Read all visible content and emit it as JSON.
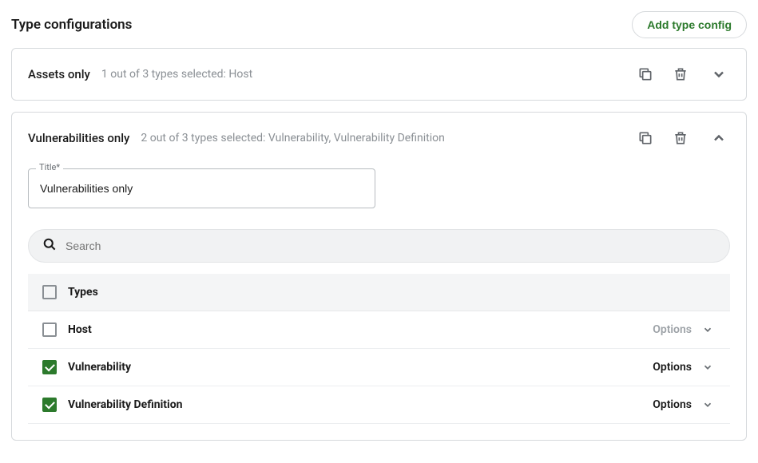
{
  "header": {
    "title": "Type configurations",
    "add_button": "Add type config"
  },
  "card1": {
    "title": "Assets only",
    "subtitle": "1 out of 3 types selected: Host"
  },
  "card2": {
    "title": "Vulnerabilities only",
    "subtitle": "2 out of 3 types selected: Vulnerability, Vulnerability Definition",
    "field_label": "Title*",
    "field_value": "Vulnerabilities only",
    "search_placeholder": "Search",
    "table_header": "Types",
    "rows": [
      {
        "name": "Host",
        "checked": false,
        "options_active": false,
        "options_label": "Options"
      },
      {
        "name": "Vulnerability",
        "checked": true,
        "options_active": true,
        "options_label": "Options"
      },
      {
        "name": "Vulnerability Definition",
        "checked": true,
        "options_active": true,
        "options_label": "Options"
      }
    ]
  }
}
